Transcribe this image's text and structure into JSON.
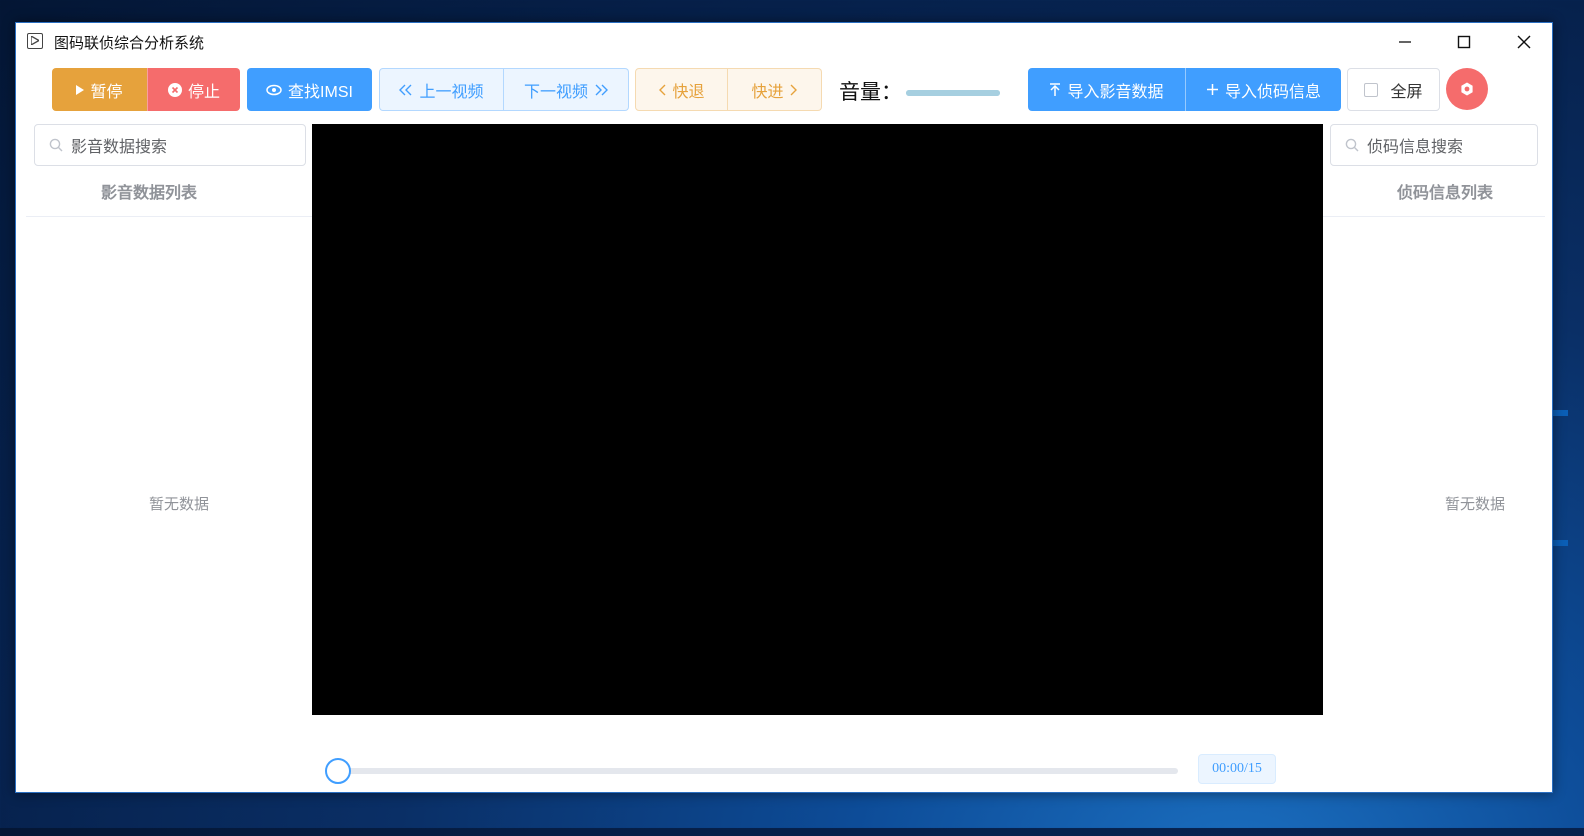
{
  "window": {
    "title": "图码联侦综合分析系统"
  },
  "toolbar": {
    "pause_label": "暂停",
    "stop_label": "停止",
    "find_imsi_label": "查找IMSI",
    "prev_video_label": "上一视频",
    "next_video_label": "下一视频",
    "rewind_label": "快退",
    "forward_label": "快进",
    "volume_label": "音量：",
    "volume_level": 1.0,
    "import_media_label": "导入影音数据",
    "import_code_label": "导入侦码信息",
    "fullscreen_label": "全屏",
    "fullscreen_checked": false
  },
  "left_panel": {
    "search_placeholder": "影音数据搜索",
    "list_header": "影音数据列表",
    "empty_text": "暂无数据"
  },
  "right_panel": {
    "search_placeholder": "侦码信息搜索",
    "list_header": "侦码信息列表",
    "empty_text": "暂无数据"
  },
  "player": {
    "progress": 0,
    "time_display": "00:00/15"
  },
  "colors": {
    "primary": "#409eff",
    "warning": "#e6a23c",
    "danger": "#f56c6c"
  },
  "icons": {
    "app": "play-square-icon",
    "pause_button": "play-triangle-icon",
    "stop_button": "close-circle-icon",
    "find_imsi": "eye-icon",
    "prev": "double-chevron-left-icon",
    "next": "double-chevron-right-icon",
    "rewind": "chevron-left-icon",
    "forward": "chevron-right-icon",
    "import_media": "upload-icon",
    "import_code": "plus-icon",
    "settings": "settings-icon",
    "search": "search-icon"
  }
}
